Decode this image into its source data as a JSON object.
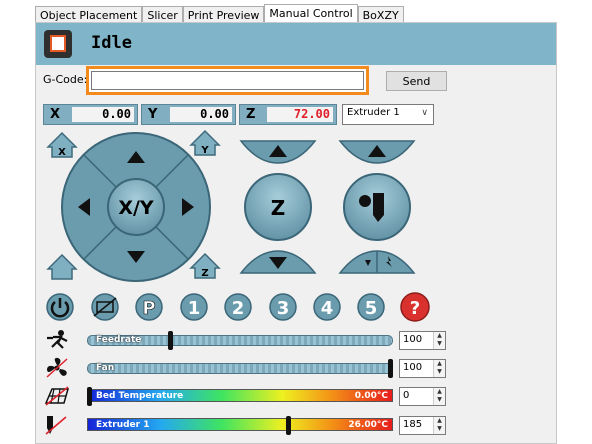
{
  "tabs": [
    {
      "label": "Object Placement"
    },
    {
      "label": "Slicer"
    },
    {
      "label": "Print Preview"
    },
    {
      "label": "Manual Control"
    },
    {
      "label": "BoXZY"
    }
  ],
  "status": {
    "text": "Idle"
  },
  "gcode": {
    "label": "G-Code:",
    "value": "",
    "send_label": "Send"
  },
  "coords": {
    "x": {
      "label": "X",
      "value": "0.00"
    },
    "y": {
      "label": "Y",
      "value": "0.00"
    },
    "z": {
      "label": "Z",
      "value": "72.00"
    }
  },
  "extruder_select": {
    "selected": "Extruder 1"
  },
  "jog": {
    "xy_label": "X/Y",
    "z_label": "Z",
    "home_x": "X",
    "home_y": "Y",
    "home_z": "Z"
  },
  "buttons": [
    "1",
    "2",
    "3",
    "4",
    "5"
  ],
  "sliders": {
    "feedrate": {
      "label": "Feedrate",
      "value": "100",
      "level": 0.27
    },
    "fan": {
      "label": "Fan",
      "value": "100",
      "level": 1.0
    }
  },
  "temps": {
    "bed": {
      "label": "Bed Temperature",
      "readout": "0.00°C",
      "value": "0",
      "level": 0.0
    },
    "extruder": {
      "label": "Extruder 1",
      "readout": "26.00°C",
      "value": "185",
      "level": 0.66
    }
  },
  "colors": {
    "accent": "#7fb4c9",
    "highlight": "#f28a1c",
    "z_value": "#e0202a",
    "stop": "#d9322e"
  }
}
